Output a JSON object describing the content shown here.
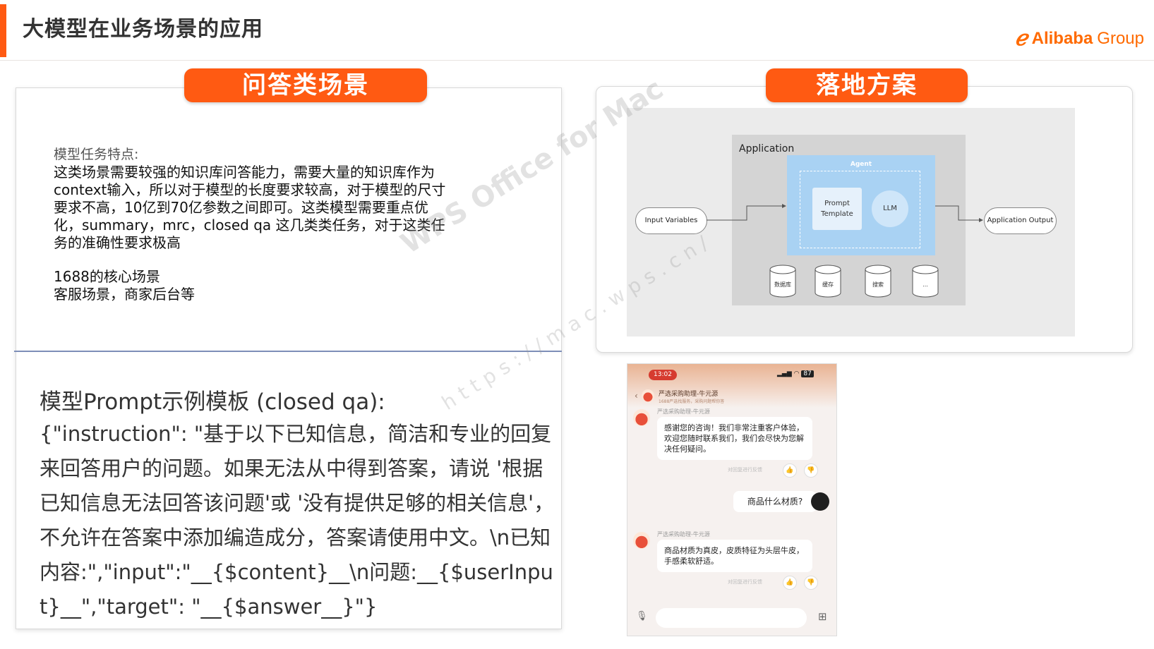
{
  "slide": {
    "title": "大模型在业务场景的应用",
    "logo_brand": "Alibaba",
    "logo_suffix": "Group"
  },
  "left": {
    "pill": "问答类场景",
    "feature_label": "模型任务特点:",
    "feature_body": "这类场景需要较强的知识库问答能力，需要大量的知识库作为context输入，所以对于模型的长度要求较高，对于模型的尺寸要求不高，10亿到70亿参数之间即可。这类模型需要重点优化，summary，mrc，closed qa 这几类类任务，对于这类任务的准确性要求极高",
    "scene_line1": "1688的核心场景",
    "scene_line2": "客服场景，商家后台等",
    "prompt_title": "模型Prompt示例模板 (closed qa):",
    "prompt_body": "{\"instruction\": \"基于以下已知信息，简洁和专业的回复来回答用户的问题。如果无法从中得到答案，请说 '根据已知信息无法回答该问题'或 '没有提供足够的相关信息'，不允许在答案中添加编造成分，答案请使用中文。\\n已知内容:\",\"input\":\"__{$content}__\\n问题:__{$userInput}__\",\"target\": \"__{$answer__}\"}"
  },
  "right": {
    "pill": "落地方案",
    "diagram": {
      "application": "Application",
      "agent": "Agent",
      "prompt_line1": "Prompt",
      "prompt_line2": "Template",
      "llm": "LLM",
      "input": "Input Variables",
      "output": "Application Output",
      "stores": [
        "数据库",
        "缓存",
        "搜索",
        "..."
      ]
    },
    "phone": {
      "time": "13:02",
      "battery": "87",
      "bot_name": "严选采购助理-牛元源",
      "bot_sub": "1688严选找服务，采购问题帮你答",
      "msg1_name": "严选采购助理-牛元源",
      "msg1": "感谢您的咨询！我们非常注重客户体验，欢迎您随时联系我们，我们会尽快为您解决任何疑问。",
      "feedback": "对回复进行反馈",
      "user_msg": "商品什么材质?",
      "msg2_name": "严选采购助理-牛元源",
      "msg2": "商品材质为真皮，皮质特征为头层牛皮，手感柔软舒适。"
    }
  },
  "watermark": {
    "line1": "WPS Office for Mac",
    "line2": "https://mac.wps.cn/"
  },
  "colors": {
    "accent": "#ff5a12",
    "agent_blue": "#a9d2f3",
    "divider": "#7e8fb8"
  }
}
